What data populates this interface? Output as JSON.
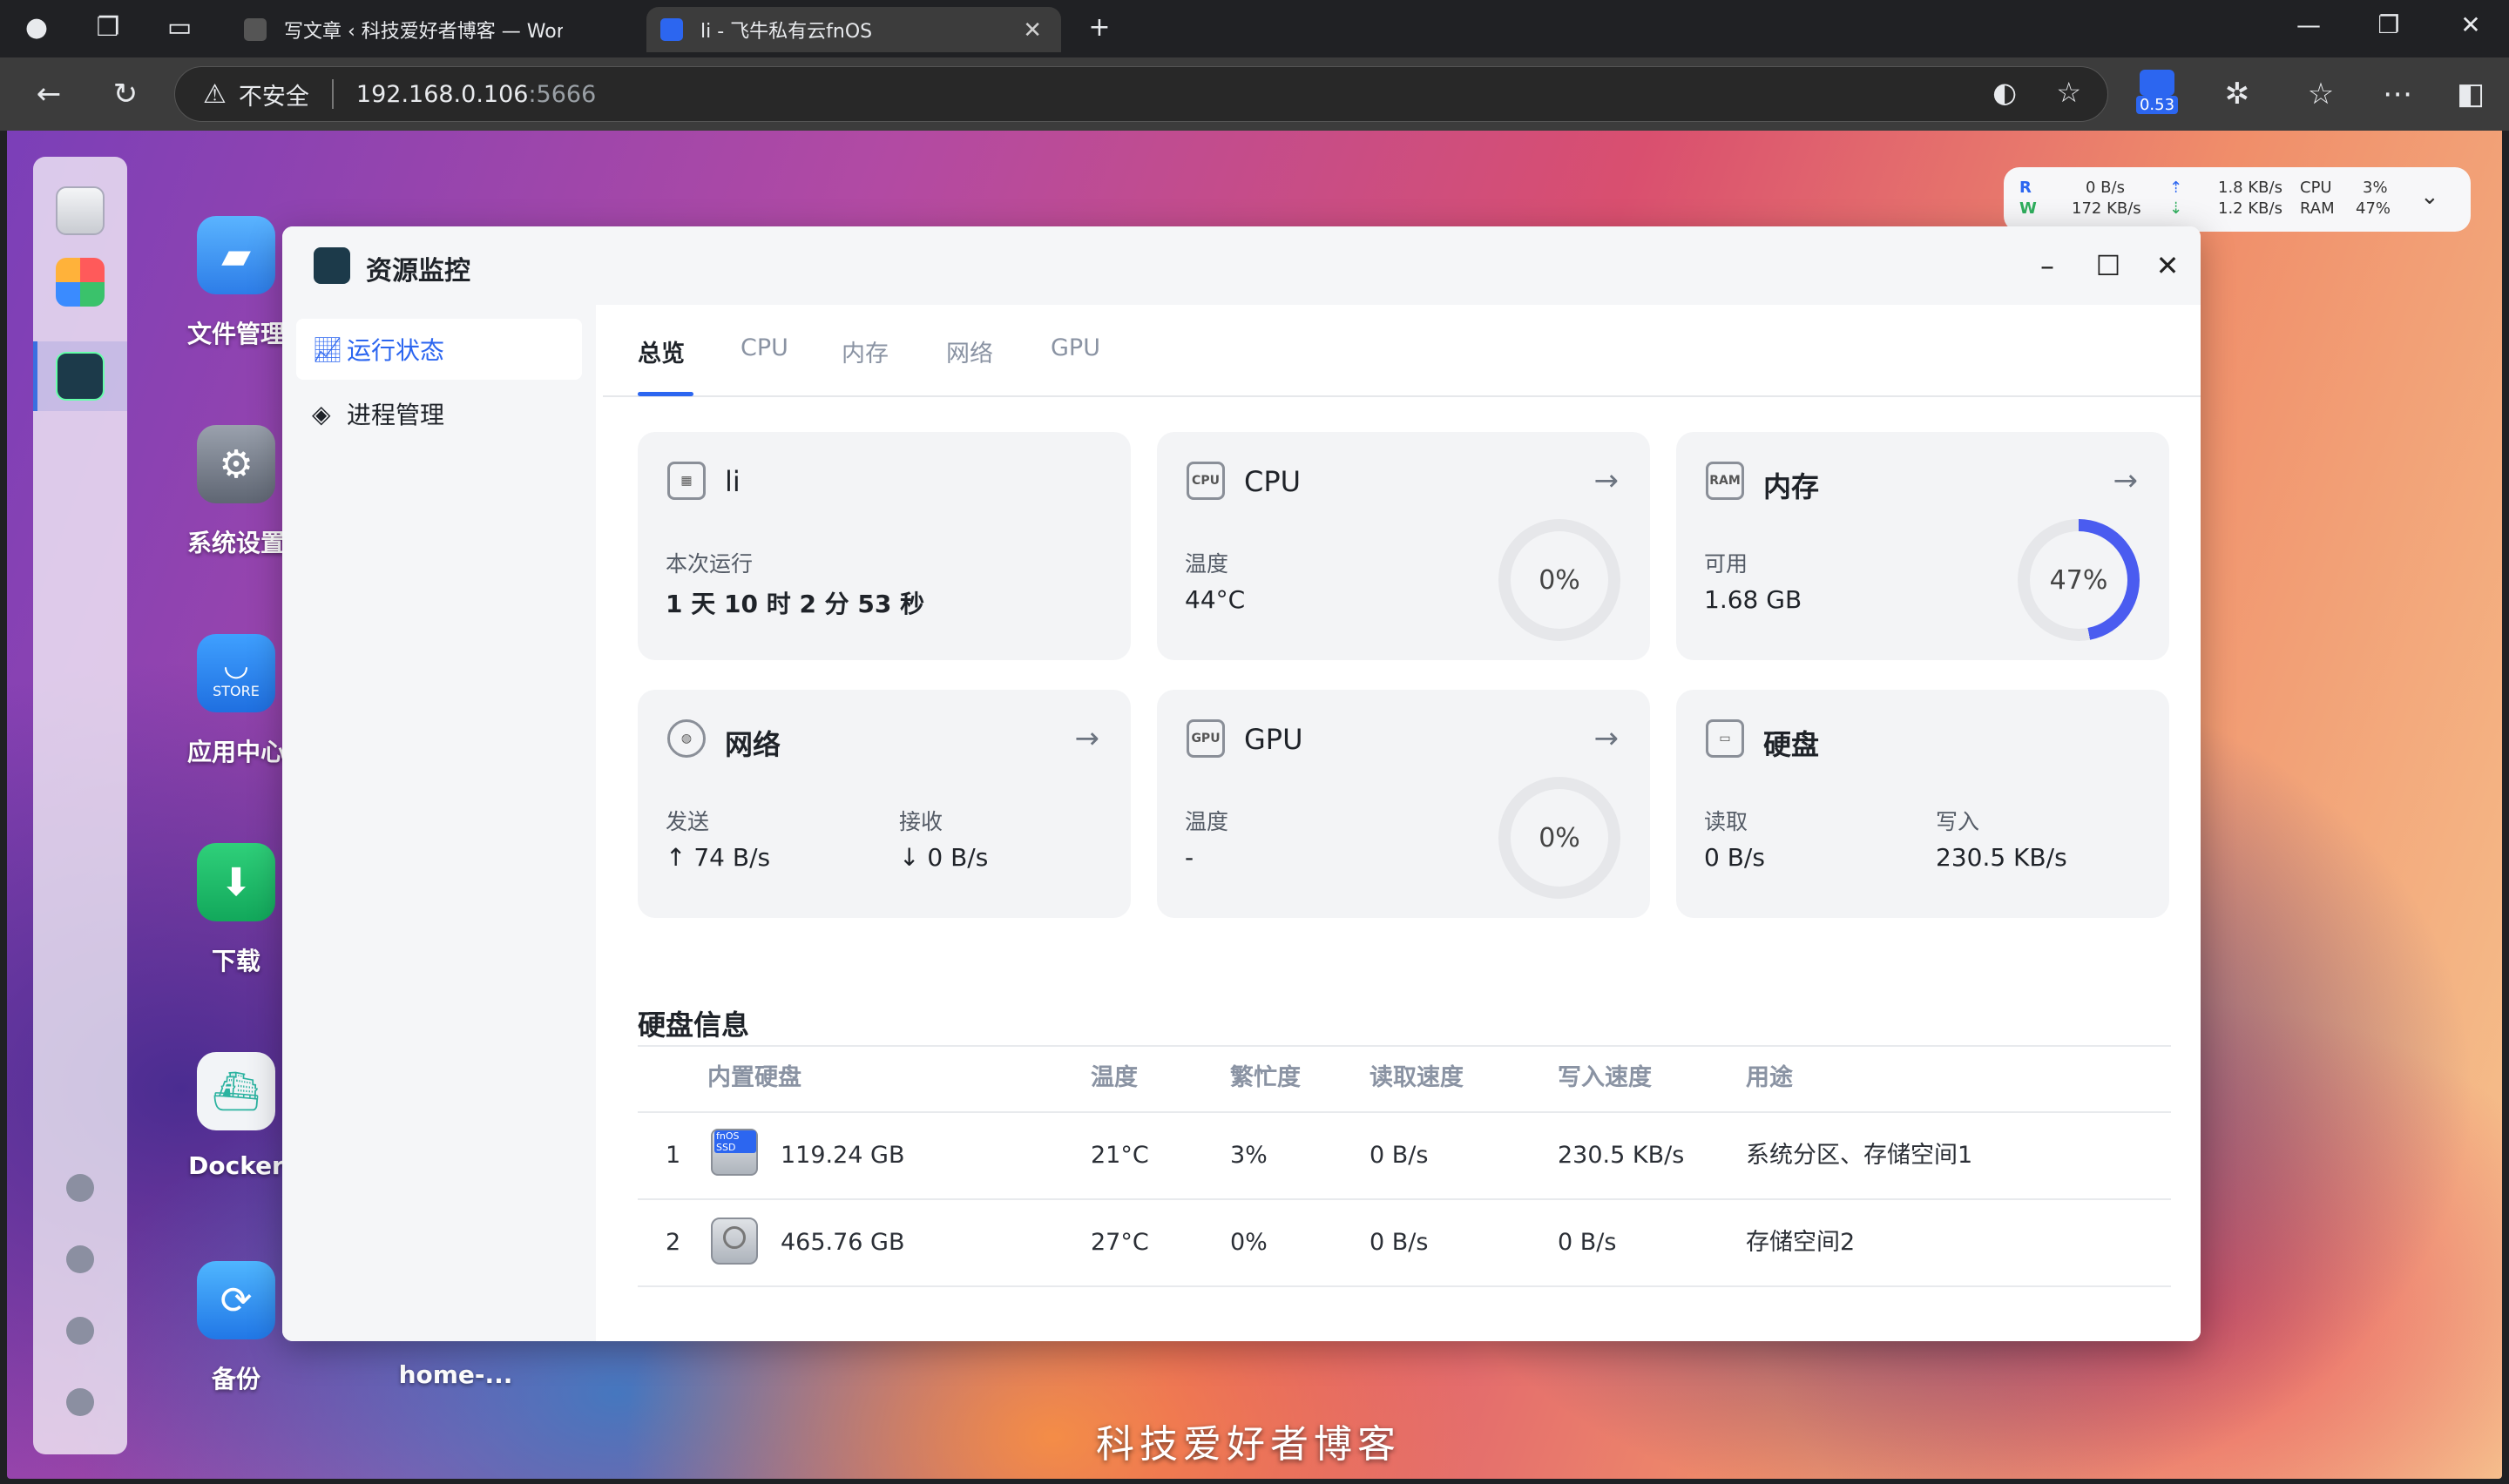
{
  "browser": {
    "tab_inactive_title": "写文章 ‹ 科技爱好者博客 — Word",
    "tab_active_title": "li - 飞牛私有云fnOS",
    "insecure_label": "不安全",
    "url_host": "192.168.0.106",
    "url_port": ":5666",
    "extension_badge": "0.53"
  },
  "desktop": {
    "apps": [
      {
        "label": "文件管理"
      },
      {
        "label": "系统设置"
      },
      {
        "label": "应用中心",
        "badge": "STORE"
      },
      {
        "label": "下载"
      },
      {
        "label": "Docker"
      },
      {
        "label": "备份"
      },
      {
        "label": "home-..."
      }
    ],
    "watermark": "科技爱好者博客"
  },
  "widget": {
    "r_label": "R",
    "w_label": "W",
    "r_rate": "0  B/s",
    "w_rate": "172 KB/s",
    "up_rate": "1.8 KB/s",
    "down_rate": "1.2 KB/s",
    "cpu_label": "CPU",
    "ram_label": "RAM",
    "cpu_value": "3%",
    "ram_value": "47%"
  },
  "window": {
    "title": "资源监控",
    "sidebar": [
      {
        "label": "运行状态"
      },
      {
        "label": "进程管理"
      }
    ],
    "tabs": [
      "总览",
      "CPU",
      "内存",
      "网络",
      "GPU"
    ],
    "cards": {
      "system": {
        "title": "li",
        "uptime_label": "本次运行",
        "uptime_value": "1 天 10 时 2 分 53 秒"
      },
      "cpu": {
        "title": "CPU",
        "temp_label": "温度",
        "temp_value": "44°C",
        "usage": "0%",
        "usage_fraction": 0
      },
      "memory": {
        "title": "内存",
        "avail_label": "可用",
        "avail_value": "1.68 GB",
        "usage": "47%",
        "usage_fraction": 0.47
      },
      "network": {
        "title": "网络",
        "send_label": "发送",
        "send_value": "↑ 74 B/s",
        "recv_label": "接收",
        "recv_value": "↓ 0 B/s"
      },
      "gpu": {
        "title": "GPU",
        "temp_label": "温度",
        "temp_value": "-",
        "usage": "0%",
        "usage_fraction": 0
      },
      "disk": {
        "title": "硬盘",
        "read_label": "读取",
        "read_value": "0 B/s",
        "write_label": "写入",
        "write_value": "230.5 KB/s"
      }
    },
    "disk_info": {
      "title": "硬盘信息",
      "headers": [
        "内置硬盘",
        "温度",
        "繁忙度",
        "读取速度",
        "写入速度",
        "用途"
      ],
      "rows": [
        {
          "index": "1",
          "badge": "fnOS SSD",
          "capacity": "119.24 GB",
          "temp": "21°C",
          "busy": "3%",
          "read": "0 B/s",
          "write": "230.5 KB/s",
          "usage": "系统分区、存储空间1"
        },
        {
          "index": "2",
          "badge": "",
          "capacity": "465.76 GB",
          "temp": "27°C",
          "busy": "0%",
          "read": "0 B/s",
          "write": "0 B/s",
          "usage": "存储空间2"
        }
      ]
    }
  },
  "colors": {
    "accent": "#2c66f0",
    "ring_track": "#e6e7ea",
    "ring_fill": "#4a5cf0"
  }
}
